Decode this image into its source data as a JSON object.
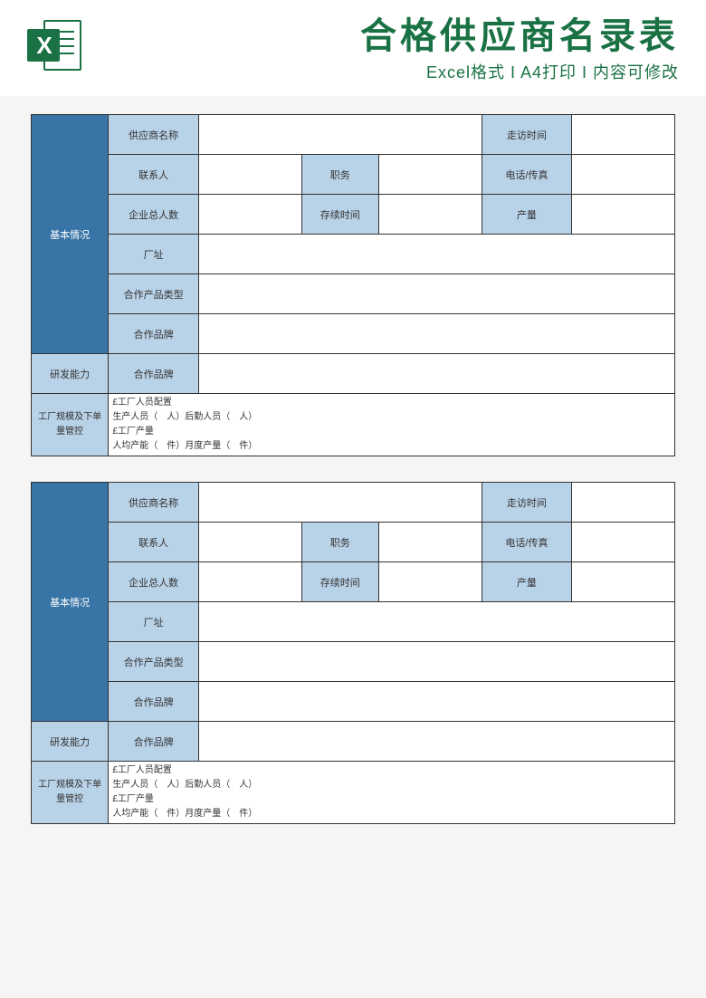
{
  "header": {
    "icon_letter": "X",
    "title": "合格供应商名录表",
    "subtitle": "Excel格式 I A4打印 I 内容可修改"
  },
  "form": {
    "section_basic": "基本情况",
    "supplier_name": "供应商名称",
    "visit_time": "走访时间",
    "contact": "联系人",
    "position": "职务",
    "phone_fax": "电话/传真",
    "total_staff": "企业总人数",
    "duration": "存续时间",
    "output": "产量",
    "address": "厂址",
    "product_type": "合作产品类型",
    "brand": "合作品牌",
    "rd_capability": "研发能力",
    "rd_brand": "合作品牌",
    "factory_scale": "工厂规模及下单量管控",
    "factory_detail_l1": "£工厂人员配置",
    "factory_detail_l2": "生产人员（　人）后勤人员（　人）",
    "factory_detail_l3": "£工厂产量",
    "factory_detail_l4": "人均产能（　件）月度产量（　件）"
  }
}
